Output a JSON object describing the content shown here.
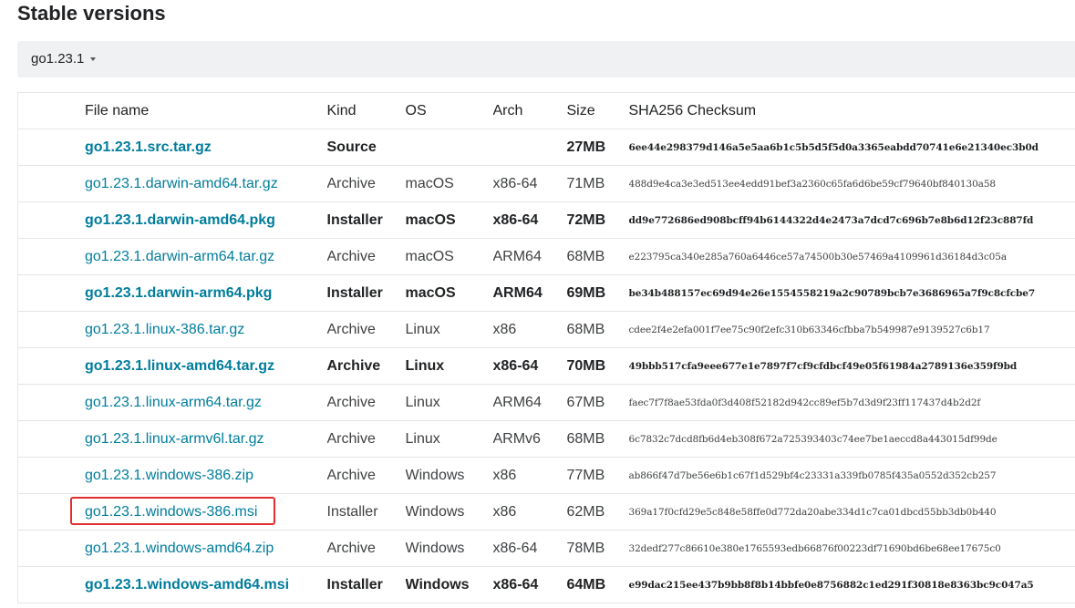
{
  "page": {
    "title": "Stable versions"
  },
  "version_selector": {
    "label": "go1.23.1"
  },
  "table": {
    "headers": {
      "file_name": "File name",
      "kind": "Kind",
      "os": "OS",
      "arch": "Arch",
      "size": "Size",
      "checksum": "SHA256 Checksum"
    },
    "rows": [
      {
        "file": "go1.23.1.src.tar.gz",
        "kind": "Source",
        "os": "",
        "arch": "",
        "size": "27MB",
        "sha": "6ee44e298379d146a5e5aa6b1c5b5d5f5d0a3365eabdd70741e6e21340ec3b0d",
        "featured": true
      },
      {
        "file": "go1.23.1.darwin-amd64.tar.gz",
        "kind": "Archive",
        "os": "macOS",
        "arch": "x86-64",
        "size": "71MB",
        "sha": "488d9e4ca3e3ed513ee4edd91bef3a2360c65fa6d6be59cf79640bf840130a58",
        "featured": false
      },
      {
        "file": "go1.23.1.darwin-amd64.pkg",
        "kind": "Installer",
        "os": "macOS",
        "arch": "x86-64",
        "size": "72MB",
        "sha": "dd9e772686ed908bcff94b6144322d4e2473a7dcd7c696b7e8b6d12f23c887fd",
        "featured": true
      },
      {
        "file": "go1.23.1.darwin-arm64.tar.gz",
        "kind": "Archive",
        "os": "macOS",
        "arch": "ARM64",
        "size": "68MB",
        "sha": "e223795ca340e285a760a6446ce57a74500b30e57469a4109961d36184d3c05a",
        "featured": false
      },
      {
        "file": "go1.23.1.darwin-arm64.pkg",
        "kind": "Installer",
        "os": "macOS",
        "arch": "ARM64",
        "size": "69MB",
        "sha": "be34b488157ec69d94e26e1554558219a2c90789bcb7e3686965a7f9c8cfcbe7",
        "featured": true
      },
      {
        "file": "go1.23.1.linux-386.tar.gz",
        "kind": "Archive",
        "os": "Linux",
        "arch": "x86",
        "size": "68MB",
        "sha": "cdee2f4e2efa001f7ee75c90f2efc310b63346cfbba7b549987e9139527c6b17",
        "featured": false
      },
      {
        "file": "go1.23.1.linux-amd64.tar.gz",
        "kind": "Archive",
        "os": "Linux",
        "arch": "x86-64",
        "size": "70MB",
        "sha": "49bbb517cfa9eee677e1e7897f7cf9cfdbcf49e05f61984a2789136e359f9bd",
        "featured": true
      },
      {
        "file": "go1.23.1.linux-arm64.tar.gz",
        "kind": "Archive",
        "os": "Linux",
        "arch": "ARM64",
        "size": "67MB",
        "sha": "faec7f7f8ae53fda0f3d408f52182d942cc89ef5b7d3d9f23ff117437d4b2d2f",
        "featured": false
      },
      {
        "file": "go1.23.1.linux-armv6l.tar.gz",
        "kind": "Archive",
        "os": "Linux",
        "arch": "ARMv6",
        "size": "68MB",
        "sha": "6c7832c7dcd8fb6d4eb308f672a725393403c74ee7be1aeccd8a443015df99de",
        "featured": false
      },
      {
        "file": "go1.23.1.windows-386.zip",
        "kind": "Archive",
        "os": "Windows",
        "arch": "x86",
        "size": "77MB",
        "sha": "ab866f47d7be56e6b1c67f1d529bf4c23331a339fb0785f435a0552d352cb257",
        "featured": false
      },
      {
        "file": "go1.23.1.windows-386.msi",
        "kind": "Installer",
        "os": "Windows",
        "arch": "x86",
        "size": "62MB",
        "sha": "369a17f0cfd29e5c848e58ffe0d772da20abe334d1c7ca01dbcd55bb3db0b440",
        "featured": false
      },
      {
        "file": "go1.23.1.windows-amd64.zip",
        "kind": "Archive",
        "os": "Windows",
        "arch": "x86-64",
        "size": "78MB",
        "sha": "32dedf277c86610e380e1765593edb66876f00223df71690bd6be68ee17675c0",
        "featured": false
      },
      {
        "file": "go1.23.1.windows-amd64.msi",
        "kind": "Installer",
        "os": "Windows",
        "arch": "x86-64",
        "size": "64MB",
        "sha": "e99dac215ee437b9bb8f8b14bbfe0e8756882c1ed291f30818e8363bc9c047a5",
        "featured": true
      }
    ]
  },
  "highlight": {
    "color": "#e12d2d",
    "target_file": "go1.23.1.windows-386.msi"
  },
  "colors": {
    "link": "#007d9c",
    "header_bar": "#f0f1f2",
    "border": "#e3e5e7"
  }
}
